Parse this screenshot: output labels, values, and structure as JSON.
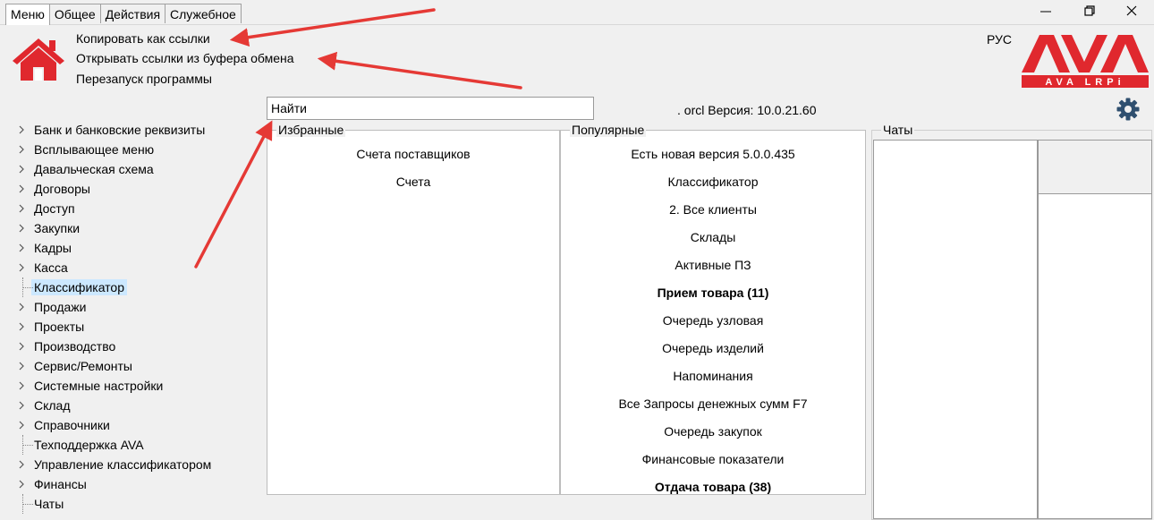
{
  "tabs": [
    {
      "label": "Меню"
    },
    {
      "label": "Общее"
    },
    {
      "label": "Действия"
    },
    {
      "label": "Служебное"
    }
  ],
  "ribbon_commands": [
    {
      "label": "Копировать как ссылки"
    },
    {
      "label": "Открывать ссылки из буфера обмена"
    },
    {
      "label": "Перезапуск программы"
    }
  ],
  "language": "РУС",
  "logo": {
    "big": "AVA",
    "small": "AVA LRPi",
    "color": "#e0282e"
  },
  "search": {
    "value": "Найти"
  },
  "version_text": ". orcl Версия: 10.0.21.60",
  "tree": [
    {
      "label": "Банк и банковские реквизиты",
      "expandable": true
    },
    {
      "label": "Всплывающее меню",
      "expandable": true
    },
    {
      "label": "Давальческая схема",
      "expandable": true
    },
    {
      "label": "Договоры",
      "expandable": true
    },
    {
      "label": "Доступ",
      "expandable": true
    },
    {
      "label": "Закупки",
      "expandable": true
    },
    {
      "label": "Кадры",
      "expandable": true
    },
    {
      "label": "Касса",
      "expandable": true
    },
    {
      "label": "Классификатор",
      "expandable": false,
      "selected": true
    },
    {
      "label": "Продажи",
      "expandable": true
    },
    {
      "label": "Проекты",
      "expandable": true
    },
    {
      "label": "Производство",
      "expandable": true
    },
    {
      "label": "Сервис/Ремонты",
      "expandable": true
    },
    {
      "label": "Системные настройки",
      "expandable": true
    },
    {
      "label": "Склад",
      "expandable": true
    },
    {
      "label": "Справочники",
      "expandable": true
    },
    {
      "label": "Техподдержка AVA",
      "expandable": false
    },
    {
      "label": "Управление классификатором",
      "expandable": true
    },
    {
      "label": "Финансы",
      "expandable": true
    },
    {
      "label": "Чаты",
      "expandable": false
    }
  ],
  "favorites": {
    "title": "Избранные",
    "items": [
      {
        "label": "Счета поставщиков"
      },
      {
        "label": "Счета"
      }
    ]
  },
  "popular": {
    "title": "Популярные",
    "items": [
      {
        "label": "Есть новая версия 5.0.0.435",
        "bold": false
      },
      {
        "label": "Классификатор",
        "bold": false
      },
      {
        "label": "2. Все клиенты",
        "bold": false
      },
      {
        "label": "Склады",
        "bold": false
      },
      {
        "label": "Активные ПЗ",
        "bold": false
      },
      {
        "label": "Прием товара (11)",
        "bold": true
      },
      {
        "label": "Очередь узловая",
        "bold": false
      },
      {
        "label": "Очередь изделий",
        "bold": false
      },
      {
        "label": "Напоминания",
        "bold": false
      },
      {
        "label": "Все Запросы денежных сумм F7",
        "bold": false
      },
      {
        "label": "Очередь закупок",
        "bold": false
      },
      {
        "label": "Финансовые показатели",
        "bold": false
      },
      {
        "label": "Отдача товара (38)",
        "bold": true
      }
    ]
  },
  "chats": {
    "title": "Чаты"
  },
  "icons": {
    "home": "home-icon",
    "gear": "gear-icon",
    "minimize": "minimize-icon",
    "restore": "restore-icon",
    "close": "close-icon",
    "chevron": "chevron-right-icon"
  },
  "colors": {
    "arrow": "#e53935",
    "home": "#e0282e",
    "selection": "#cce8ff",
    "gear": "#2f4f6f"
  }
}
